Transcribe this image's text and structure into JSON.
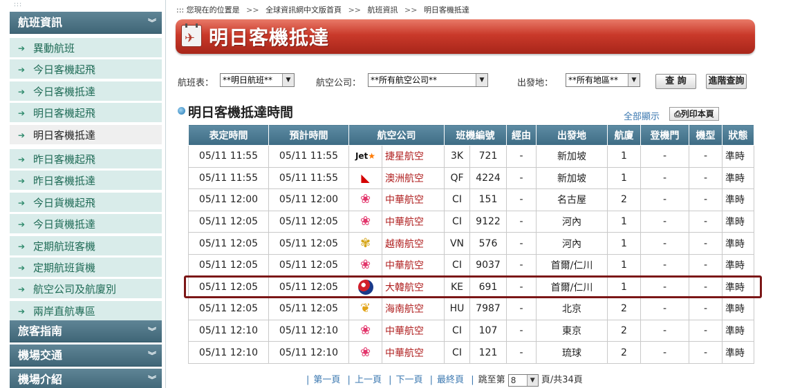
{
  "sidebar": {
    "grip": ":::",
    "section_flight": "航班資訊",
    "items": [
      {
        "label": "異動航班"
      },
      {
        "label": "今日客機起飛"
      },
      {
        "label": "今日客機抵達"
      },
      {
        "label": "明日客機起飛"
      },
      {
        "label": "明日客機抵達"
      },
      {
        "label": "昨日客機起飛"
      },
      {
        "label": "昨日客機抵達"
      },
      {
        "label": "今日貨機起飛"
      },
      {
        "label": "今日貨機抵達"
      },
      {
        "label": "定期航班客機"
      },
      {
        "label": "定期航班貨機"
      },
      {
        "label": "航空公司及航廈別"
      },
      {
        "label": "兩岸直航專區"
      }
    ],
    "section_travel": "旅客指南",
    "section_traffic": "機場交通",
    "section_intro": "機場介紹",
    "chevron": "»"
  },
  "breadcrumb": {
    "prefix": "::: 您現在的位置是",
    "sep": ">>",
    "home": "全球資訊網中文版首頁",
    "flight": "航班資訊",
    "current": "明日客機抵達"
  },
  "title": "明日客機抵達",
  "filters": {
    "schedule_label": "航班表：",
    "schedule_value": "**明日航班**",
    "airline_label": "航空公司：",
    "airline_value": "**所有航空公司**",
    "origin_label": "出發地：",
    "origin_value": "**所有地區**",
    "query_button": "查 詢",
    "advanced_button": "進階查詢"
  },
  "section_title": "明日客機抵達時間",
  "show_all": "全部顯示",
  "print_button": "列印本頁",
  "table": {
    "headers": [
      "表定時間",
      "預計時間",
      "航空公司",
      "班機編號",
      "經由",
      "出發地",
      "航廈",
      "登機門",
      "機型",
      "狀態"
    ],
    "rows": [
      {
        "sched": "05/11 11:55",
        "est": "05/11 11:55",
        "logo": "jetstar",
        "airline": "捷星航空",
        "code": "3K",
        "num": "721",
        "via": "-",
        "origin": "新加坡",
        "terminal": "1",
        "gate": "-",
        "type": "-",
        "status": "準時"
      },
      {
        "sched": "05/11 11:55",
        "est": "05/11 11:55",
        "logo": "qantas",
        "airline": "澳洲航空",
        "code": "QF",
        "num": "4224",
        "via": "-",
        "origin": "新加坡",
        "terminal": "1",
        "gate": "-",
        "type": "-",
        "status": "準時"
      },
      {
        "sched": "05/11 12:00",
        "est": "05/11 12:00",
        "logo": "china",
        "airline": "中華航空",
        "code": "CI",
        "num": "151",
        "via": "-",
        "origin": "名古屋",
        "terminal": "2",
        "gate": "-",
        "type": "-",
        "status": "準時"
      },
      {
        "sched": "05/11 12:05",
        "est": "05/11 12:05",
        "logo": "china",
        "airline": "中華航空",
        "code": "CI",
        "num": "9122",
        "via": "-",
        "origin": "河內",
        "terminal": "1",
        "gate": "-",
        "type": "-",
        "status": "準時"
      },
      {
        "sched": "05/11 12:05",
        "est": "05/11 12:05",
        "logo": "vn",
        "airline": "越南航空",
        "code": "VN",
        "num": "576",
        "via": "-",
        "origin": "河內",
        "terminal": "1",
        "gate": "-",
        "type": "-",
        "status": "準時"
      },
      {
        "sched": "05/11 12:05",
        "est": "05/11 12:05",
        "logo": "china",
        "airline": "中華航空",
        "code": "CI",
        "num": "9037",
        "via": "-",
        "origin": "首爾/仁川",
        "terminal": "1",
        "gate": "-",
        "type": "-",
        "status": "準時"
      },
      {
        "sched": "05/11 12:05",
        "est": "05/11 12:05",
        "logo": "korean",
        "airline": "大韓航空",
        "code": "KE",
        "num": "691",
        "via": "-",
        "origin": "首爾/仁川",
        "terminal": "1",
        "gate": "-",
        "type": "-",
        "status": "準時"
      },
      {
        "sched": "05/11 12:05",
        "est": "05/11 12:05",
        "logo": "hainan",
        "airline": "海南航空",
        "code": "HU",
        "num": "7987",
        "via": "-",
        "origin": "北京",
        "terminal": "2",
        "gate": "-",
        "type": "-",
        "status": "準時"
      },
      {
        "sched": "05/11 12:10",
        "est": "05/11 12:10",
        "logo": "china",
        "airline": "中華航空",
        "code": "CI",
        "num": "107",
        "via": "-",
        "origin": "東京",
        "terminal": "2",
        "gate": "-",
        "type": "-",
        "status": "準時"
      },
      {
        "sched": "05/11 12:10",
        "est": "05/11 12:10",
        "logo": "china",
        "airline": "中華航空",
        "code": "CI",
        "num": "121",
        "via": "-",
        "origin": "琉球",
        "terminal": "2",
        "gate": "-",
        "type": "-",
        "status": "準時"
      }
    ]
  },
  "pager": {
    "first": "第一頁",
    "prev": "上一頁",
    "next": "下一頁",
    "last": "最終頁",
    "jump_label": "跳至第",
    "page_value": "8",
    "total": "頁/共34頁"
  }
}
